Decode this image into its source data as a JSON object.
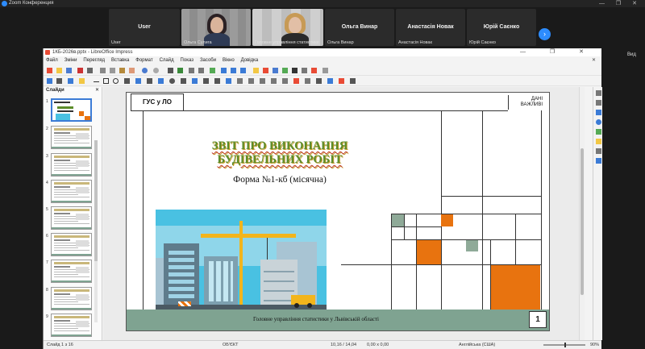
{
  "zoom": {
    "window_title": "Zoom Конференция",
    "participants": [
      {
        "center_name": "User",
        "corner_name": "User"
      },
      {
        "center_name": "",
        "corner_name": "Ольга Сулига"
      },
      {
        "center_name": "",
        "corner_name": "Головне управління статистики"
      },
      {
        "center_name": "Ольга Винар",
        "corner_name": "Ольга Винар"
      },
      {
        "center_name": "Анастасія Новак",
        "corner_name": "Анастасія Новак"
      },
      {
        "center_name": "Юрій Саєнко",
        "corner_name": "Юрій Саєнко"
      }
    ],
    "next_icon": "chevron-right-icon",
    "view_label": "Вид"
  },
  "app": {
    "window_title": "1КБ-2026в.pptx - LibreOffice Impress",
    "menu": [
      "Файл",
      "Зміни",
      "Перегляд",
      "Вставка",
      "Формат",
      "Слайд",
      "Показ",
      "Засоби",
      "Вікно",
      "Довідка"
    ]
  },
  "slides_pane": {
    "title": "Слайди",
    "thumb_numbers": [
      "1",
      "2",
      "3",
      "4",
      "5",
      "6",
      "7",
      "8",
      "9"
    ]
  },
  "slide": {
    "org": "ГУС у ЛО",
    "badge_line1": "ДАНІ",
    "badge_line2": "ВАЖЛИВІ",
    "title_line1": "ЗВІТ ПРО ВИКОНАННЯ",
    "title_line2": "БУДІВЕЛЬНИХ РОБІТ",
    "subtitle": "Форма №1-кб (місячна)",
    "footer": "Головне управління статистики у Львівській області",
    "page_number": "1"
  },
  "status": {
    "slide_indicator": "Слайд 1 з 16",
    "selection": "ОБ'ЄКТ",
    "position": "10,16 / 14,04",
    "size": "0,00 x 0,00",
    "language": "Англійська (США)",
    "zoom": "90%"
  },
  "colors": {
    "accent_orange": "#e8730f",
    "accent_green": "#8faa98",
    "title_green": "#5c8c2a",
    "footer_bg": "#7fa391"
  }
}
